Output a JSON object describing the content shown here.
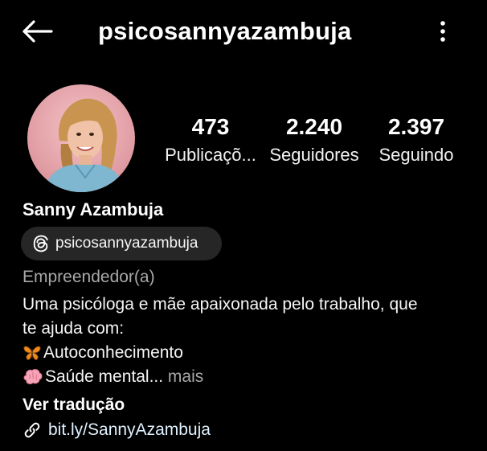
{
  "header": {
    "title": "psicosannyazambuja",
    "back_icon": "arrow-left-icon",
    "more_icon": "more-vertical-icon"
  },
  "profile": {
    "avatar": "profile-photo",
    "stats": {
      "posts": {
        "value": "473",
        "label": "Publicaçõ..."
      },
      "followers": {
        "value": "2.240",
        "label": "Seguidores"
      },
      "following": {
        "value": "2.397",
        "label": "Seguindo"
      }
    },
    "display_name": "Sanny Azambuja",
    "threads_handle": "psicosannyazambuja",
    "category": "Empreendedor(a)",
    "bio": {
      "line1": "Uma psicóloga e mãe apaixonada pelo trabalho, que",
      "line2": "te ajuda com:",
      "line3": "Autoconhecimento",
      "line4": "Saúde mental...",
      "more": " mais"
    },
    "translate_label": "Ver tradução",
    "link": "bit.ly/SannyAzambuja"
  },
  "colors": {
    "background": "#000000",
    "text": "#ffffff",
    "muted": "#a8a8a8",
    "badge_bg": "#262626",
    "link": "#e0f1ff"
  }
}
